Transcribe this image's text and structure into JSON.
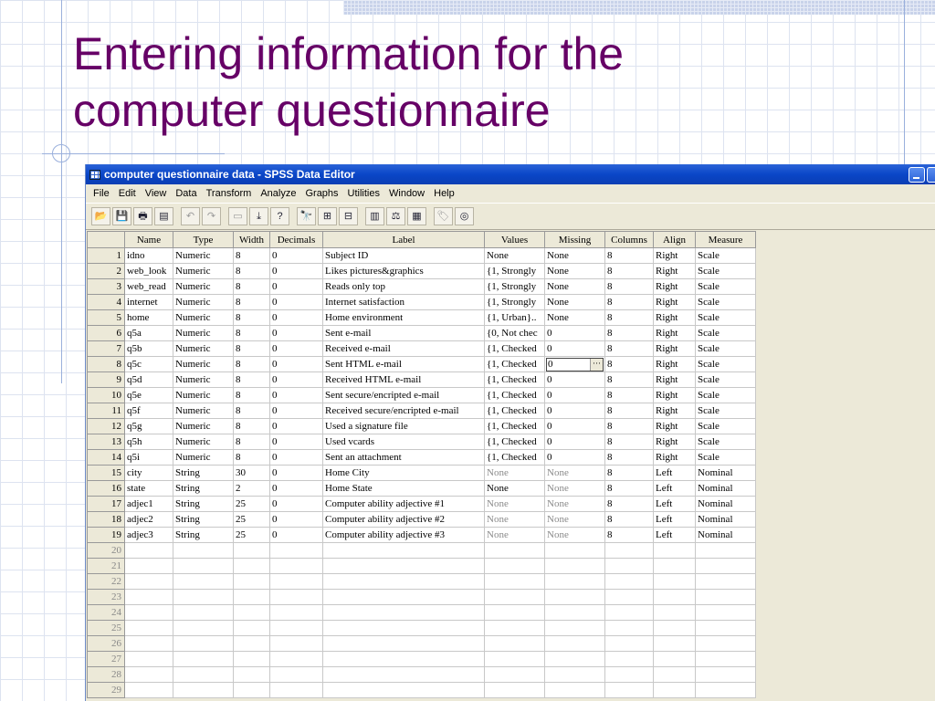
{
  "slide": {
    "title_line1": "Entering information for the",
    "title_line2": "computer questionnaire"
  },
  "window": {
    "title": "computer questionnaire data - SPSS Data Editor"
  },
  "menu": [
    "File",
    "Edit",
    "View",
    "Data",
    "Transform",
    "Analyze",
    "Graphs",
    "Utilities",
    "Window",
    "Help"
  ],
  "toolbar": [
    {
      "name": "open-icon",
      "glyph": "📂"
    },
    {
      "name": "save-icon",
      "glyph": "💾"
    },
    {
      "name": "print-icon",
      "glyph": "🖶"
    },
    {
      "name": "dialog-recall-icon",
      "glyph": "▤"
    },
    {
      "sep": true
    },
    {
      "name": "undo-icon",
      "glyph": "↶",
      "dim": true
    },
    {
      "name": "redo-icon",
      "glyph": "↷",
      "dim": true
    },
    {
      "sep": true
    },
    {
      "name": "goto-chart-icon",
      "glyph": "▭",
      "dim": true
    },
    {
      "name": "goto-case-icon",
      "glyph": "⤓"
    },
    {
      "name": "variables-icon",
      "glyph": "?"
    },
    {
      "sep": true
    },
    {
      "name": "find-icon",
      "glyph": "🔭",
      "dim": true
    },
    {
      "name": "insert-case-icon",
      "glyph": "⊞"
    },
    {
      "name": "insert-variable-icon",
      "glyph": "⊟"
    },
    {
      "sep": true
    },
    {
      "name": "split-file-icon",
      "glyph": "▥"
    },
    {
      "name": "weight-cases-icon",
      "glyph": "⚖"
    },
    {
      "name": "select-cases-icon",
      "glyph": "▦"
    },
    {
      "sep": true
    },
    {
      "name": "value-labels-icon",
      "glyph": "🏷",
      "dim": true
    },
    {
      "name": "use-sets-icon",
      "glyph": "◎"
    }
  ],
  "grid": {
    "columns": [
      "Name",
      "Type",
      "Width",
      "Decimals",
      "Label",
      "Values",
      "Missing",
      "Columns",
      "Align",
      "Measure"
    ],
    "rows": [
      [
        "idno",
        "Numeric",
        "8",
        "0",
        "Subject ID",
        "None",
        "None",
        "8",
        "Right",
        "Scale"
      ],
      [
        "web_look",
        "Numeric",
        "8",
        "0",
        "Likes pictures&graphics",
        "{1, Strongly",
        "None",
        "8",
        "Right",
        "Scale"
      ],
      [
        "web_read",
        "Numeric",
        "8",
        "0",
        "Reads only top",
        "{1, Strongly",
        "None",
        "8",
        "Right",
        "Scale"
      ],
      [
        "internet",
        "Numeric",
        "8",
        "0",
        "Internet satisfaction",
        "{1, Strongly",
        "None",
        "8",
        "Right",
        "Scale"
      ],
      [
        "home",
        "Numeric",
        "8",
        "0",
        "Home environment",
        "{1, Urban}..",
        "None",
        "8",
        "Right",
        "Scale"
      ],
      [
        "q5a",
        "Numeric",
        "8",
        "0",
        "Sent e-mail",
        "{0, Not chec",
        "0",
        "8",
        "Right",
        "Scale"
      ],
      [
        "q5b",
        "Numeric",
        "8",
        "0",
        "Received e-mail",
        "{1, Checked",
        "0",
        "8",
        "Right",
        "Scale"
      ],
      [
        "q5c",
        "Numeric",
        "8",
        "0",
        "Sent HTML e-mail",
        "{1, Checked",
        "0",
        "8",
        "Right",
        "Scale"
      ],
      [
        "q5d",
        "Numeric",
        "8",
        "0",
        "Received HTML e-mail",
        "{1, Checked",
        "0",
        "8",
        "Right",
        "Scale"
      ],
      [
        "q5e",
        "Numeric",
        "8",
        "0",
        "Sent secure/encripted e-mail",
        "{1, Checked",
        "0",
        "8",
        "Right",
        "Scale"
      ],
      [
        "q5f",
        "Numeric",
        "8",
        "0",
        "Received secure/encripted e-mail",
        "{1, Checked",
        "0",
        "8",
        "Right",
        "Scale"
      ],
      [
        "q5g",
        "Numeric",
        "8",
        "0",
        "Used a signature file",
        "{1, Checked",
        "0",
        "8",
        "Right",
        "Scale"
      ],
      [
        "q5h",
        "Numeric",
        "8",
        "0",
        "Used vcards",
        "{1, Checked",
        "0",
        "8",
        "Right",
        "Scale"
      ],
      [
        "q5i",
        "Numeric",
        "8",
        "0",
        "Sent an attachment",
        "{1, Checked",
        "0",
        "8",
        "Right",
        "Scale"
      ],
      [
        "city",
        "String",
        "30",
        "0",
        "Home City",
        "None",
        "None",
        "8",
        "Left",
        "Nominal"
      ],
      [
        "state",
        "String",
        "2",
        "0",
        "Home State",
        "None",
        "None",
        "8",
        "Left",
        "Nominal"
      ],
      [
        "adjec1",
        "String",
        "25",
        "0",
        "Computer ability adjective #1",
        "None",
        "None",
        "8",
        "Left",
        "Nominal"
      ],
      [
        "adjec2",
        "String",
        "25",
        "0",
        "Computer ability adjective #2",
        "None",
        "None",
        "8",
        "Left",
        "Nominal"
      ],
      [
        "adjec3",
        "String",
        "25",
        "0",
        "Computer ability adjective #3",
        "None",
        "None",
        "8",
        "Left",
        "Nominal"
      ]
    ],
    "empty_row_numbers": [
      "20",
      "21",
      "22",
      "23",
      "24",
      "25",
      "26",
      "27",
      "28",
      "29"
    ]
  },
  "selected_cell": {
    "row": 7,
    "col": 6
  },
  "colors": {
    "title": "#660066",
    "titlebar": "#0a46c8"
  }
}
